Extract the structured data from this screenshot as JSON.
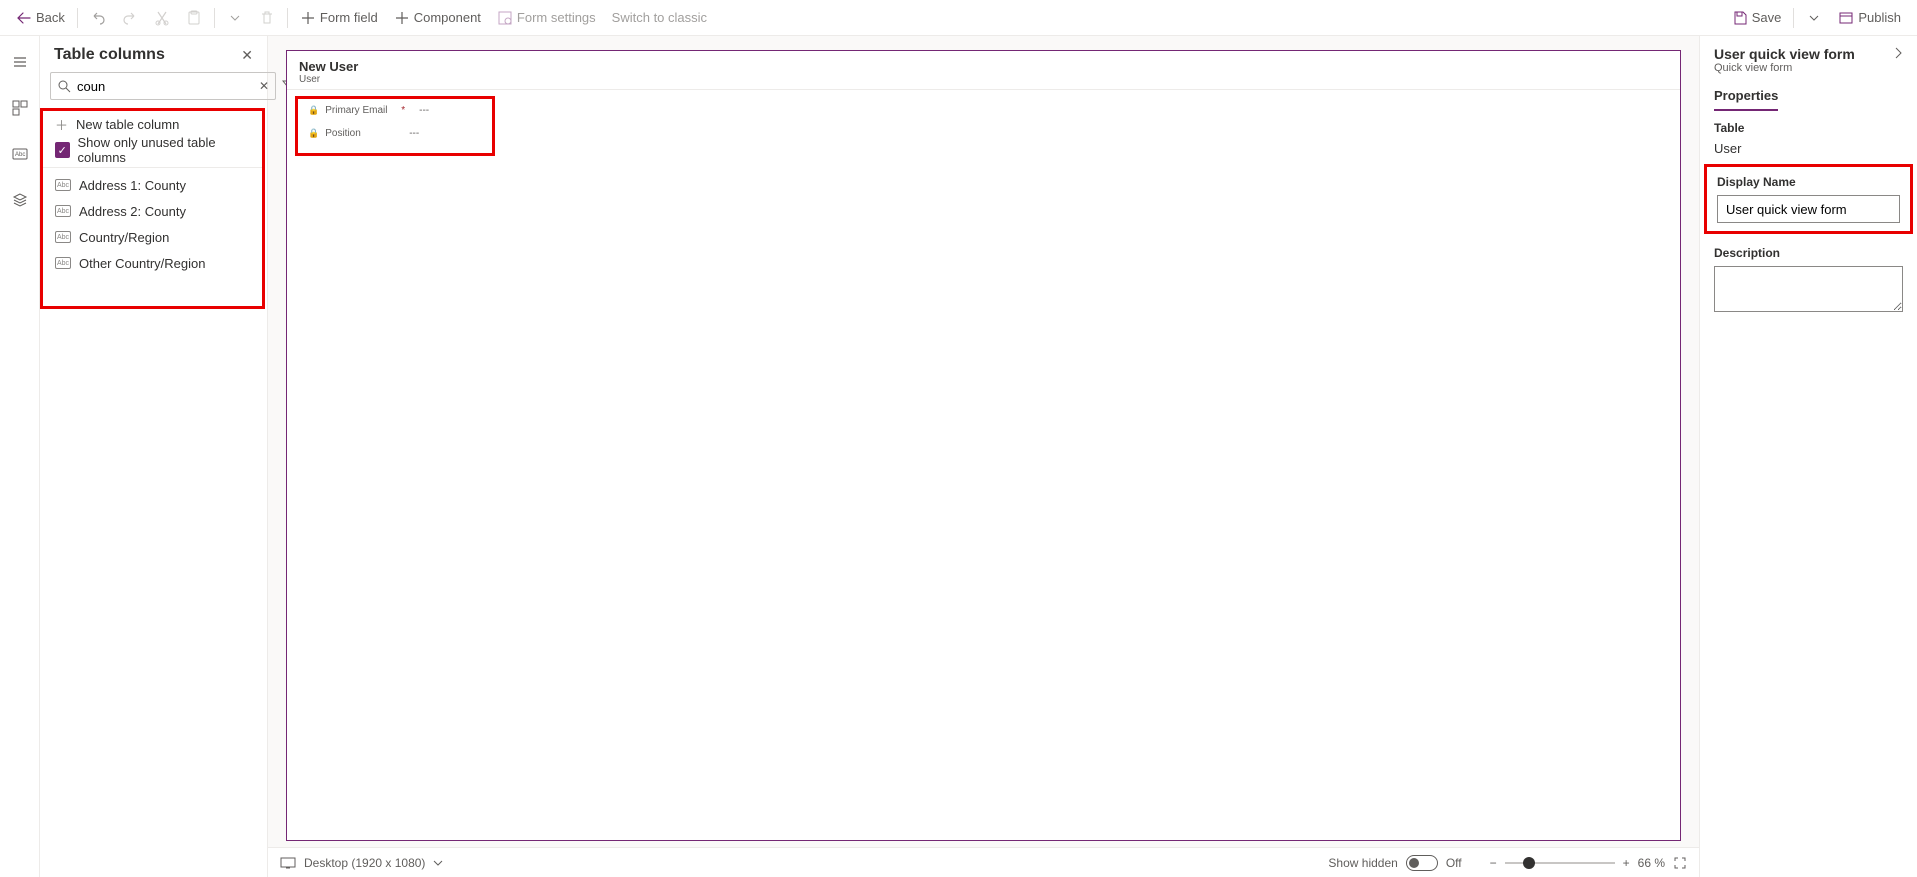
{
  "toolbar": {
    "back": "Back",
    "form_field": "Form field",
    "component": "Component",
    "form_settings": "Form settings",
    "switch_classic": "Switch to classic",
    "save": "Save",
    "publish": "Publish"
  },
  "leftPanel": {
    "title": "Table columns",
    "searchValue": "coun",
    "newColumn": "New table column",
    "showUnused": "Show only unused table columns",
    "columns": [
      "Address 1: County",
      "Address 2: County",
      "Country/Region",
      "Other Country/Region"
    ]
  },
  "form": {
    "title": "New User",
    "entity": "User",
    "fields": [
      {
        "label": "Primary Email",
        "required": true,
        "value": "---"
      },
      {
        "label": "Position",
        "required": false,
        "value": "---"
      }
    ]
  },
  "statusbar": {
    "device": "Desktop (1920 x 1080)",
    "showHidden": "Show hidden",
    "off": "Off",
    "zoom": "66 %"
  },
  "props": {
    "title": "User quick view form",
    "subtitle": "Quick view form",
    "tab": "Properties",
    "tableLabel": "Table",
    "tableValue": "User",
    "displayNameLabel": "Display Name",
    "displayNameValue": "User quick view form",
    "descriptionLabel": "Description",
    "descriptionValue": ""
  }
}
